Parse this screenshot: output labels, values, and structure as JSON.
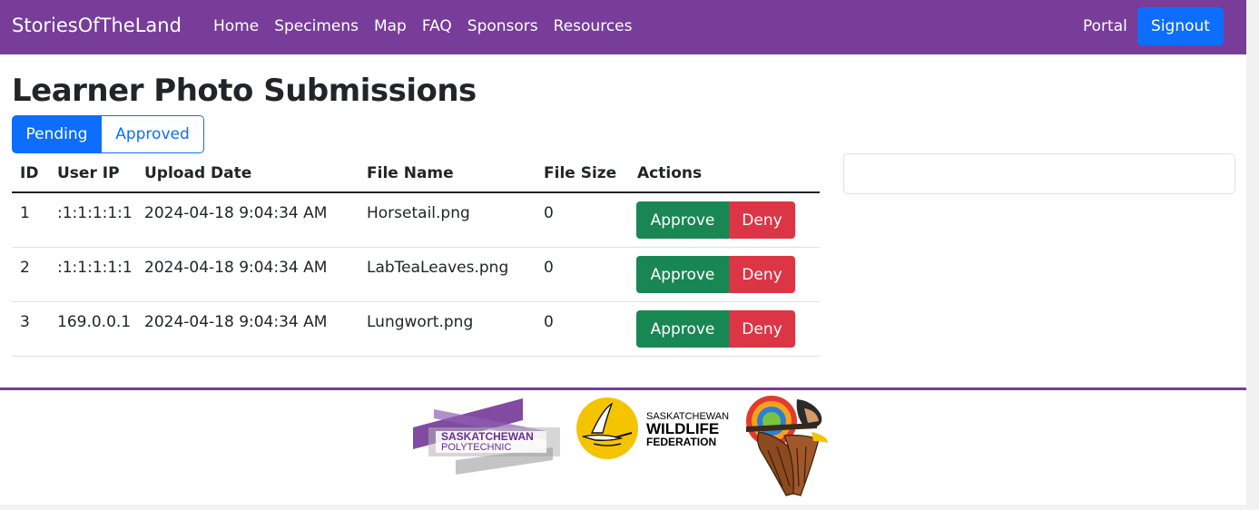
{
  "nav": {
    "brand": "StoriesOfTheLand",
    "links": [
      "Home",
      "Specimens",
      "Map",
      "FAQ",
      "Sponsors",
      "Resources"
    ],
    "portal": "Portal",
    "signout": "Signout"
  },
  "page": {
    "title": "Learner Photo Submissions",
    "tabs": [
      {
        "label": "Pending",
        "active": true
      },
      {
        "label": "Approved",
        "active": false
      }
    ]
  },
  "table": {
    "headers": [
      "ID",
      "User IP",
      "Upload Date",
      "File Name",
      "File Size",
      "Actions"
    ],
    "rows": [
      {
        "id": "1",
        "ip": ":1:1:1:1:1",
        "date": "2024-04-18 9:04:34 AM",
        "file": "Horsetail.png",
        "size": "0",
        "approve": "Approve",
        "deny": "Deny"
      },
      {
        "id": "2",
        "ip": ":1:1:1:1:1",
        "date": "2024-04-18 9:04:34 AM",
        "file": "LabTeaLeaves.png",
        "size": "0",
        "approve": "Approve",
        "deny": "Deny"
      },
      {
        "id": "3",
        "ip": "169.0.0.1",
        "date": "2024-04-18 9:04:34 AM",
        "file": "Lungwort.png",
        "size": "0",
        "approve": "Approve",
        "deny": "Deny"
      }
    ]
  },
  "footer": {
    "sask_poly": {
      "line1": "SASKATCHEWAN",
      "line2": "POLYTECHNIC"
    },
    "swf": {
      "line1": "SASKATCHEWAN",
      "line2": "WILDLIFE",
      "line3": "FEDERATION"
    }
  },
  "colors": {
    "navbar": "#773d99",
    "primary": "#0d6efd",
    "approve": "#198754",
    "deny": "#dc3545"
  },
  "icons": {
    "logo_sask_polytechnic": "sask-polytechnic-logo",
    "logo_swf": "crane-emblem-logo",
    "logo_first_nations": "eagle-headdress-logo"
  }
}
